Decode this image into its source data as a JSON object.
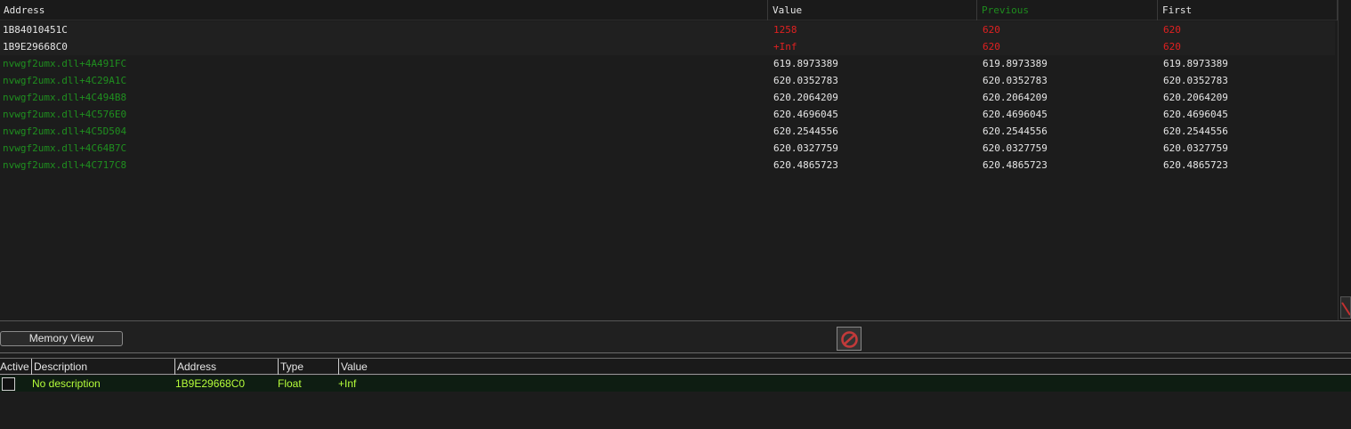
{
  "results": {
    "headers": {
      "address": "Address",
      "value": "Value",
      "previous": "Previous",
      "first": "First"
    },
    "rows": [
      {
        "address": "1B84010451C",
        "value": "1258",
        "previous": "620",
        "first": "620",
        "address_color": "white",
        "value_color": "red"
      },
      {
        "address": "1B9E29668C0",
        "value": "+Inf",
        "previous": "620",
        "first": "620",
        "address_color": "white",
        "value_color": "red"
      },
      {
        "address": "nvwgf2umx.dll+4A491FC",
        "value": "619.8973389",
        "previous": "619.8973389",
        "first": "619.8973389",
        "address_color": "green",
        "value_color": "white"
      },
      {
        "address": "nvwgf2umx.dll+4C29A1C",
        "value": "620.0352783",
        "previous": "620.0352783",
        "first": "620.0352783",
        "address_color": "green",
        "value_color": "white"
      },
      {
        "address": "nvwgf2umx.dll+4C494B8",
        "value": "620.2064209",
        "previous": "620.2064209",
        "first": "620.2064209",
        "address_color": "green",
        "value_color": "white"
      },
      {
        "address": "nvwgf2umx.dll+4C576E0",
        "value": "620.4696045",
        "previous": "620.4696045",
        "first": "620.4696045",
        "address_color": "green",
        "value_color": "white"
      },
      {
        "address": "nvwgf2umx.dll+4C5D504",
        "value": "620.2544556",
        "previous": "620.2544556",
        "first": "620.2544556",
        "address_color": "green",
        "value_color": "white"
      },
      {
        "address": "nvwgf2umx.dll+4C64B7C",
        "value": "620.0327759",
        "previous": "620.0327759",
        "first": "620.0327759",
        "address_color": "green",
        "value_color": "white"
      },
      {
        "address": "nvwgf2umx.dll+4C717C8",
        "value": "620.4865723",
        "previous": "620.4865723",
        "first": "620.4865723",
        "address_color": "green",
        "value_color": "white"
      }
    ]
  },
  "toolbar": {
    "memory_view_label": "Memory View",
    "stop_icon": "no-entry-icon"
  },
  "address_list": {
    "headers": {
      "active": "Active",
      "description": "Description",
      "address": "Address",
      "type": "Type",
      "value": "Value"
    },
    "rows": [
      {
        "active": false,
        "description": "No description",
        "address": "1B9E29668C0",
        "type": "Float",
        "value": "+Inf"
      }
    ]
  },
  "colors": {
    "background": "#1c1c1c",
    "changed_value": "#e02020",
    "static_address": "#1f8f1f",
    "selected_row_text": "#b6ff3a"
  }
}
